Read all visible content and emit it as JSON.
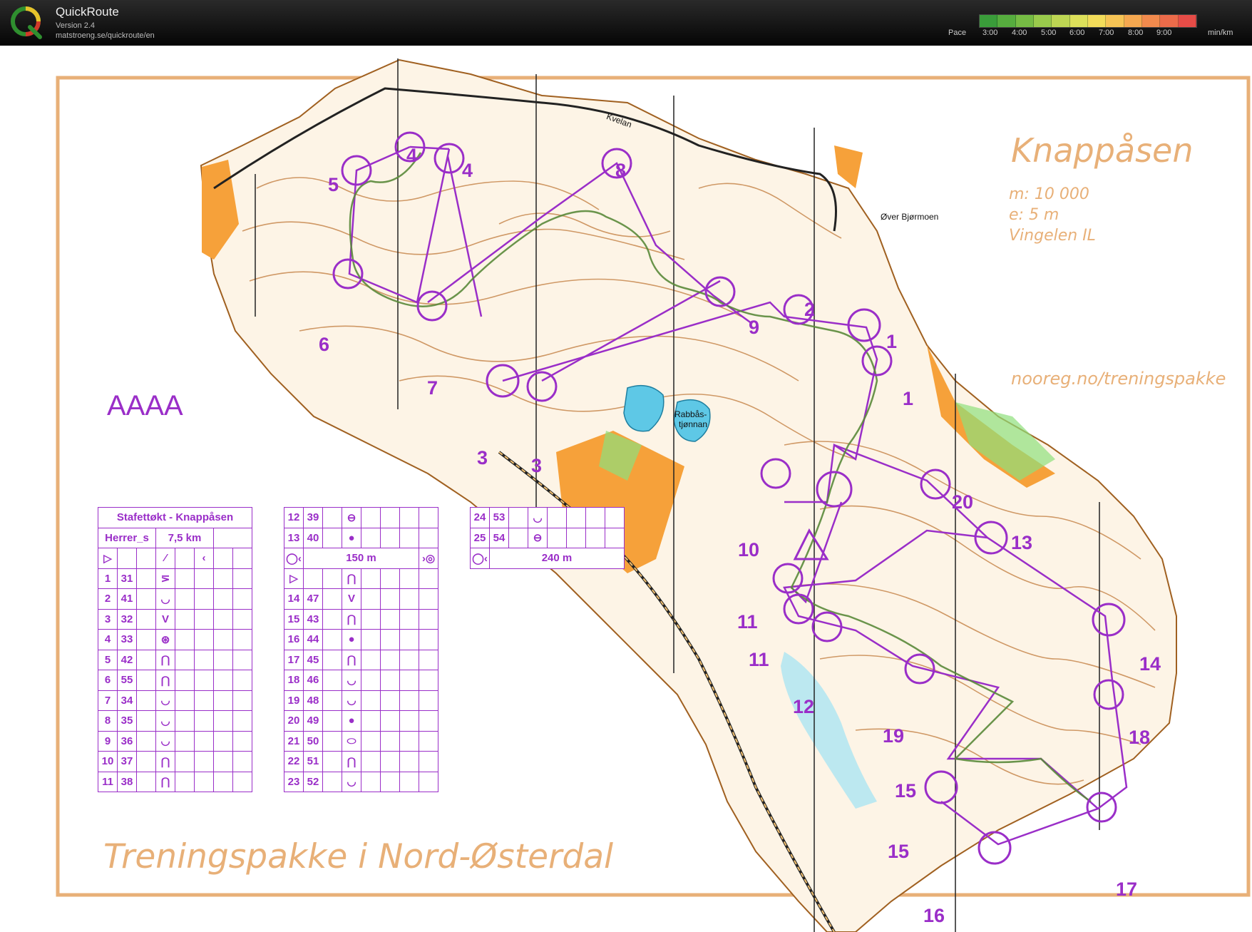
{
  "app": {
    "title": "QuickRoute",
    "version": "Version 2.4",
    "url": "matstroeng.se/quickroute/en"
  },
  "pace_legend": {
    "label": "Pace",
    "ticks": [
      "3:00",
      "4:00",
      "5:00",
      "6:00",
      "7:00",
      "8:00",
      "9:00"
    ],
    "unit": "min/km",
    "colors": [
      "#3a9d3a",
      "#56ad3e",
      "#76bc44",
      "#9acb4c",
      "#bdd653",
      "#dde05a",
      "#f2dc5a",
      "#f6c455",
      "#f5a850",
      "#f18a4d",
      "#ec6b4a",
      "#e64c47"
    ]
  },
  "map": {
    "title": "Knappåsen",
    "scale": "m: 10 000",
    "equidistance": "e: 5 m",
    "club": "Vingelen IL",
    "website": "nooreg.no/treningspakke",
    "footer": "Treningspakke i Nord-Østerdal",
    "course_label": "AAAA",
    "place_names": [
      "Øver Bjørmoen",
      "Kvelan",
      "Rabbås-",
      "tjønnan"
    ],
    "colors": {
      "course": "#9a2ec8",
      "frame": "#e8b078",
      "contours": "#c07a3a",
      "yellow": "#f6a13a",
      "water": "#5ec8e6",
      "green": "#8fe07c"
    },
    "control_numbers": [
      "1",
      "1",
      "2",
      "3",
      "3",
      "4",
      "4",
      "5",
      "6",
      "7",
      "8",
      "9",
      "10",
      "11",
      "11",
      "12",
      "13",
      "14",
      "15",
      "15",
      "16",
      "17",
      "18",
      "19",
      "20"
    ]
  },
  "description_sheet": {
    "title": "Stafettøkt - Knappåsen",
    "class": "Herrer_s",
    "length": "7,5 km",
    "rows_a": [
      {
        "n": "1",
        "code": "31",
        "sym": "⋝"
      },
      {
        "n": "2",
        "code": "41",
        "sym": "◡"
      },
      {
        "n": "3",
        "code": "32",
        "sym": "V"
      },
      {
        "n": "4",
        "code": "33",
        "sym": "⊛"
      },
      {
        "n": "5",
        "code": "42",
        "sym": "⋂"
      },
      {
        "n": "6",
        "code": "55",
        "sym": "⋂"
      },
      {
        "n": "7",
        "code": "34",
        "sym": "◡"
      },
      {
        "n": "8",
        "code": "35",
        "sym": "◡"
      },
      {
        "n": "9",
        "code": "36",
        "sym": "◡"
      },
      {
        "n": "10",
        "code": "37",
        "sym": "⋂"
      },
      {
        "n": "11",
        "code": "38",
        "sym": "⋂"
      }
    ],
    "rows_b_top": [
      {
        "n": "12",
        "code": "39",
        "sym": "⊖"
      },
      {
        "n": "13",
        "code": "40",
        "sym": "●"
      }
    ],
    "leg_b": "150 m",
    "rows_b": [
      {
        "n": "14",
        "code": "47",
        "sym": "V"
      },
      {
        "n": "15",
        "code": "43",
        "sym": "⋂"
      },
      {
        "n": "16",
        "code": "44",
        "sym": "●"
      },
      {
        "n": "17",
        "code": "45",
        "sym": "⋂"
      },
      {
        "n": "18",
        "code": "46",
        "sym": "◡"
      },
      {
        "n": "19",
        "code": "48",
        "sym": "◡"
      },
      {
        "n": "20",
        "code": "49",
        "sym": "●"
      },
      {
        "n": "21",
        "code": "50",
        "sym": "⬭"
      },
      {
        "n": "22",
        "code": "51",
        "sym": "⋂"
      },
      {
        "n": "23",
        "code": "52",
        "sym": "◡"
      }
    ],
    "rows_c": [
      {
        "n": "24",
        "code": "53",
        "sym": "◡"
      },
      {
        "n": "25",
        "code": "54",
        "sym": "⊖"
      }
    ],
    "leg_c": "240 m"
  }
}
